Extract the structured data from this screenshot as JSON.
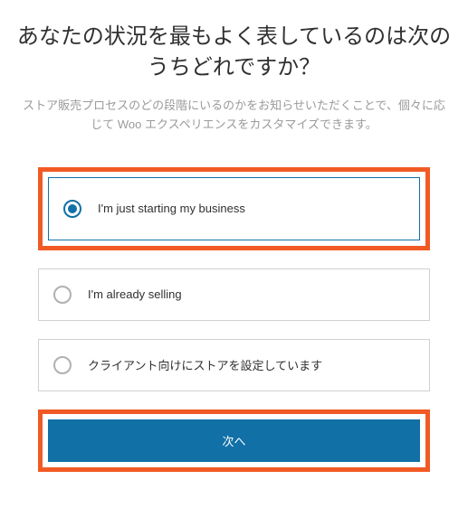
{
  "heading": "あなたの状況を最もよく表しているのは次のうちどれですか？",
  "description": "ストア販売プロセスのどの段階にいるのかをお知らせいただくことで、個々に応じて Woo エクスペリエンスをカスタマイズできます。",
  "options": [
    {
      "label": "I'm just starting my business",
      "selected": true,
      "highlighted": true
    },
    {
      "label": "I'm already selling",
      "selected": false,
      "highlighted": false
    },
    {
      "label": "クライアント向けにストアを設定しています",
      "selected": false,
      "highlighted": false
    }
  ],
  "next_button": {
    "label": "次へ",
    "highlighted": true
  }
}
